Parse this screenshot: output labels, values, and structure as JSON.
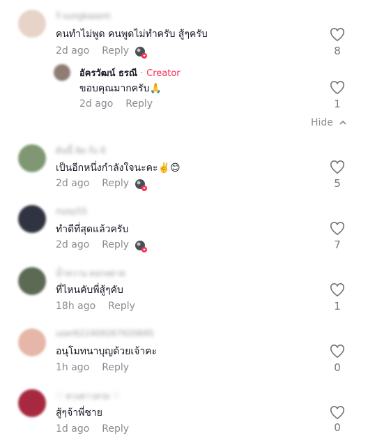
{
  "comments": [
    {
      "username": "ร้ sungkasem",
      "text": "คนทำไม่พูด คนพูดไม่ทำครับ สู้ๆครับ",
      "time": "2d ago",
      "reply_label": "Reply",
      "likes": "8",
      "creator_liked": true,
      "avatar_color": "#e8d3c9",
      "reply": {
        "username": "อัครวัฒน์ ธรณี",
        "separator": "·",
        "badge": "Creator",
        "text": "ขอบคุณมากครับ🙏",
        "time": "2d ago",
        "reply_label": "Reply",
        "likes": "1",
        "avatar_color": "#8d7d72"
      },
      "hide_label": "Hide"
    },
    {
      "username": "ต้นนี้ ลิด กิ่ง ลิ",
      "text": "เป็นอีกหนึ่งกำลังใจนะคะ✌️😊",
      "time": "2d ago",
      "reply_label": "Reply",
      "likes": "5",
      "creator_liked": true,
      "avatar_color": "#7f9873"
    },
    {
      "username": "nuoy55",
      "text": "ทำดีที่สุดแล้วครับ",
      "time": "2d ago",
      "reply_label": "Reply",
      "likes": "7",
      "creator_liked": true,
      "avatar_color": "#2f3440"
    },
    {
      "username": "น้ำหวาน ดอกลดาด",
      "text": "ที่ไหนคับพี่สู้ๆคับ",
      "time": "18h ago",
      "reply_label": "Reply",
      "likes": "1",
      "creator_liked": false,
      "avatar_color": "#5c6a55"
    },
    {
      "username": "user622409267920695",
      "text": "อนุโมทนาบุญด้วยเจ้าคะ",
      "time": "1h ago",
      "reply_label": "Reply",
      "likes": "0",
      "creator_liked": false,
      "avatar_color": "#e6b7a8"
    },
    {
      "username": "♡ ดวงดาวสวย ♡",
      "text": "สู้ๆจ้าพี่ชาย",
      "time": "1d ago",
      "reply_label": "Reply",
      "likes": "0",
      "creator_liked": false,
      "avatar_color": "#a8293f"
    }
  ],
  "colors": {
    "text": "#161823",
    "muted": "#8a8b91",
    "creator": "#fe2c55"
  }
}
